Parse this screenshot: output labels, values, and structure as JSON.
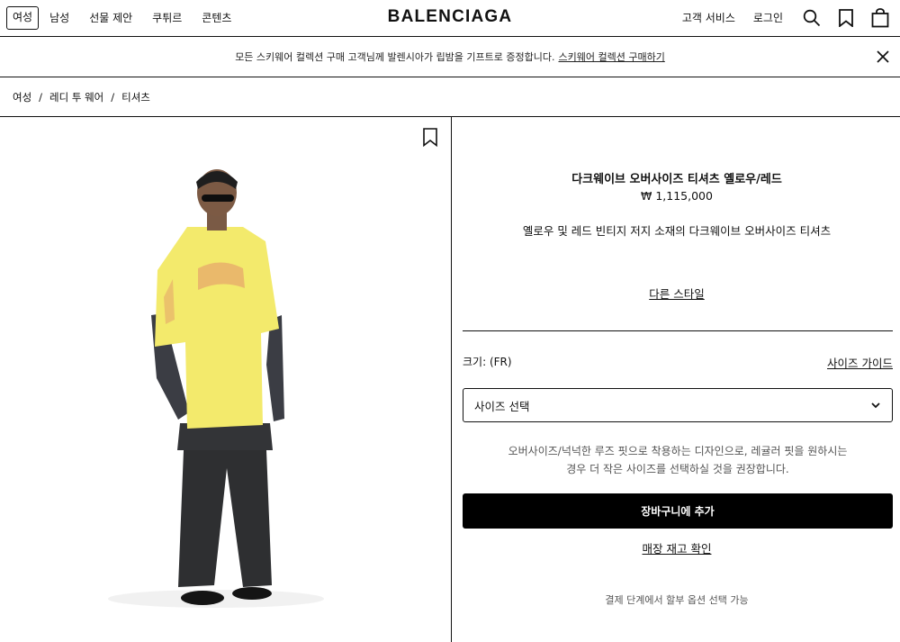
{
  "header": {
    "nav_left": [
      "여성",
      "남성",
      "선물 제안",
      "쿠튀르",
      "콘텐츠"
    ],
    "logo": "BALENCIAGA",
    "nav_right": [
      "고객 서비스",
      "로그인"
    ],
    "icons": [
      "search-icon",
      "bookmark-icon",
      "shopping-bag-icon"
    ]
  },
  "banner": {
    "text": "모든 스키웨어 컬렉션 구매 고객님께 발렌시아가 립밤을 기프트로 증정합니다.",
    "link": "스키웨어 컬렉션 구매하기"
  },
  "breadcrumb": [
    "여성",
    "레디 투 웨어",
    "티셔츠"
  ],
  "product": {
    "title": "다크웨이브 오버사이즈 티셔츠 옐로우/레드",
    "price": "₩ 1,115,000",
    "description": "옐로우 및 레드 빈티지 저지 소재의 다크웨이브 오버사이즈 티셔츠",
    "other_styles": "다른 스타일",
    "size_label": "크기: (FR)",
    "size_guide": "사이즈 가이드",
    "size_select": "사이즈 선택",
    "fit_note_line1": "오버사이즈/넉넉한 루즈 핏으로 착용하는 디자인으로, 레귤러 핏을 원하시는",
    "fit_note_line2": "경우 더 작은 사이즈를 선택하실 것을 권장합니다.",
    "add_to_cart": "장바구니에 추가",
    "store_stock": "매장 재고 확인",
    "payment_note": "결제 단계에서 할부 옵션 선택 가능"
  },
  "colors": {
    "shirt": "#f3ea6c",
    "sleeves": "#3b3d44",
    "pants": "#2e2f31",
    "button_bg": "#000000",
    "button_text": "#ffffff"
  }
}
